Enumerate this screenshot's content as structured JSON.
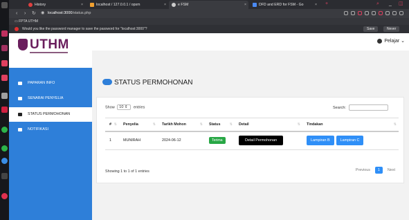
{
  "browser": {
    "tabs": [
      {
        "title": "History",
        "favicon_color": "#e04040"
      },
      {
        "title": "localhost / 127.0.0.1 / opsm",
        "favicon_color": "#f0a030"
      },
      {
        "title": "e FSM",
        "favicon_color": "#cccccc",
        "active": true
      },
      {
        "title": "DFD and ERD for FSM - Go",
        "favicon_color": "#4a8af4"
      }
    ],
    "url_host": "localhost:3000",
    "url_path": "/status.php",
    "bookmark": "FPTA UTHM",
    "password_prompt": "Would you like the password manager to save the password for \"localhost:3000\"?",
    "save_label": "Save",
    "never_label": "Never"
  },
  "app": {
    "logo_text": "UTHM",
    "brand_color": "#6a1e5d",
    "accent_color": "#2e7fd9",
    "sidebar": [
      {
        "label": "PAPARAN INFO",
        "icon": "dashboard-icon"
      },
      {
        "label": "SENARAI PENYELIA",
        "icon": "person-icon"
      },
      {
        "label": "STATUS PERMOHONAN",
        "icon": "cloud-icon",
        "active": true
      },
      {
        "label": "NOTIFIKASI",
        "icon": "bell-icon"
      }
    ],
    "user_label": "Pelajar"
  },
  "page": {
    "title": "STATUS PERMOHONAN",
    "show_label": "Show",
    "show_value": "10",
    "entries_label": "entries",
    "search_label": "Search:",
    "table": {
      "headers": [
        "#",
        "Penyelia",
        "Tarikh Mohon",
        "Status",
        "Detail",
        "Tindakan"
      ],
      "rows": [
        {
          "num": "1",
          "penyelia": "MUNIRAH",
          "tarikh": "2024-06-12",
          "status": "Terima",
          "detail": "Detail Permohonan",
          "actions": [
            "Lampiran B",
            "Lampiran C"
          ]
        }
      ]
    },
    "info": "Showing 1 to 1 of 1 entries",
    "pager": {
      "prev": "Previous",
      "current": "1",
      "next": "Next"
    }
  }
}
